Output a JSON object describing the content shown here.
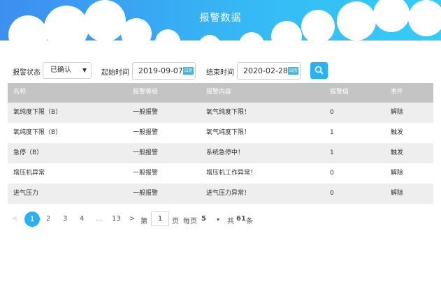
{
  "header": {
    "title": "报警数据",
    "colors": {
      "gradient_start": "#3d8ef0",
      "gradient_end": "#33cdf8",
      "cloud": "#ffffff"
    }
  },
  "filters": {
    "status_label": "报警状态",
    "status_value": "已确认",
    "start_label": "起始时间",
    "start_value": "2019-09-07",
    "end_label": "结束时间",
    "end_value": "2020-02-28",
    "calendar_icon_text": "日历",
    "search_icon": "search-icon"
  },
  "table": {
    "columns": [
      "名称",
      "报警等级",
      "报警内容",
      "报警值",
      "事件"
    ],
    "rows": [
      [
        "氧纯度下限（B）",
        "一般报警",
        "氧气纯度下限！",
        "0",
        "解除"
      ],
      [
        "氧纯度下限（B）",
        "一般报警",
        "氧气纯度下限！",
        "1",
        "触发"
      ],
      [
        "急停（B）",
        "一般报警",
        "系统急停中！",
        "1",
        "触发"
      ],
      [
        "增压机异常",
        "一般报警",
        "增压机工作异常！",
        "0",
        "解除"
      ],
      [
        "进气压力",
        "一般报警",
        "进气压力异常！",
        "0",
        "解除"
      ]
    ]
  },
  "pagination": {
    "prev": "<",
    "pages": [
      "1",
      "2",
      "3",
      "4"
    ],
    "ellipsis": "...",
    "last_page": "13",
    "next": ">",
    "goto_prefix": "第",
    "goto_value": "1",
    "goto_suffix": "页",
    "per_page_label": "每页",
    "per_page_value": "5",
    "per_page_caret": "▾",
    "total_prefix": "共",
    "total_count": "61",
    "total_suffix": "条",
    "accent": "#29b1f1"
  }
}
